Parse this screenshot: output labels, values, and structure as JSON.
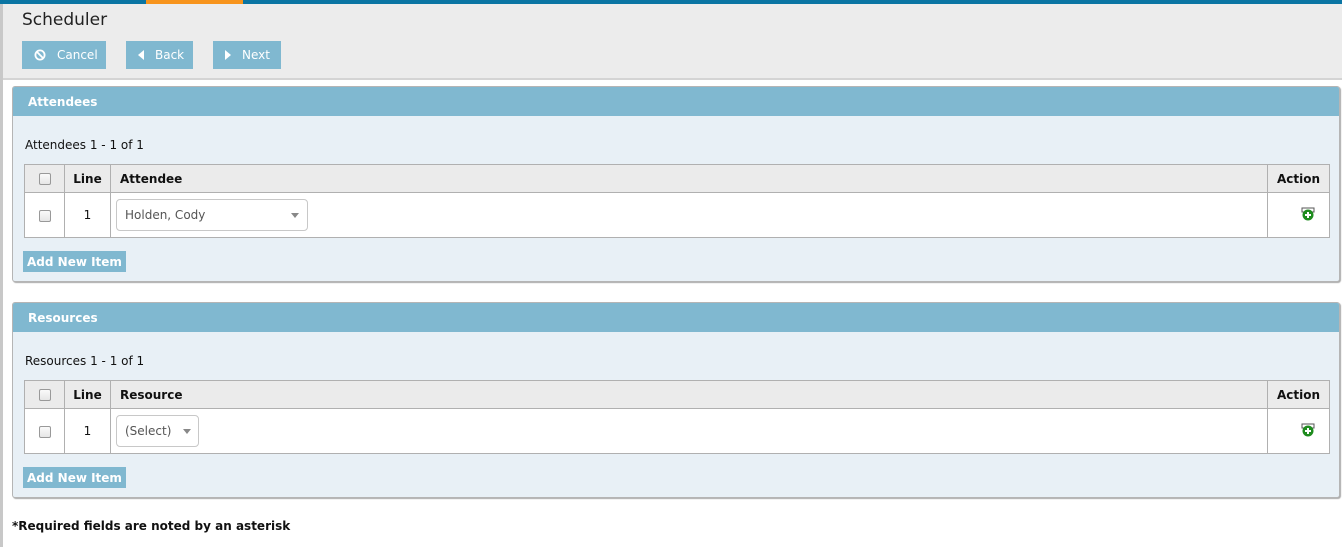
{
  "header": {
    "title": "Scheduler",
    "buttons": {
      "cancel": "Cancel",
      "back": "Back",
      "next": "Next"
    }
  },
  "attendees": {
    "title": "Attendees",
    "count_text": "Attendees 1 - 1 of 1",
    "columns": [
      "",
      "Line",
      "Attendee",
      "Action"
    ],
    "rows": [
      {
        "checked": false,
        "line": "1",
        "value": "Holden, Cody"
      }
    ],
    "add_button": "Add New Item"
  },
  "resources": {
    "title": "Resources",
    "count_text": "Resources 1 - 1 of 1",
    "columns": [
      "",
      "Line",
      "Resource",
      "Action"
    ],
    "rows": [
      {
        "checked": false,
        "line": "1",
        "value": "(Select)"
      }
    ],
    "add_button": "Add New Item"
  },
  "footnote": "*Required fields are noted by an asterisk",
  "colors": {
    "topbar": "#0a75a3",
    "topbar_active": "#f7941d",
    "accent": "#80b8d0",
    "panel_bg": "#e8f0f6",
    "action_icon": "#1e8c1e"
  }
}
